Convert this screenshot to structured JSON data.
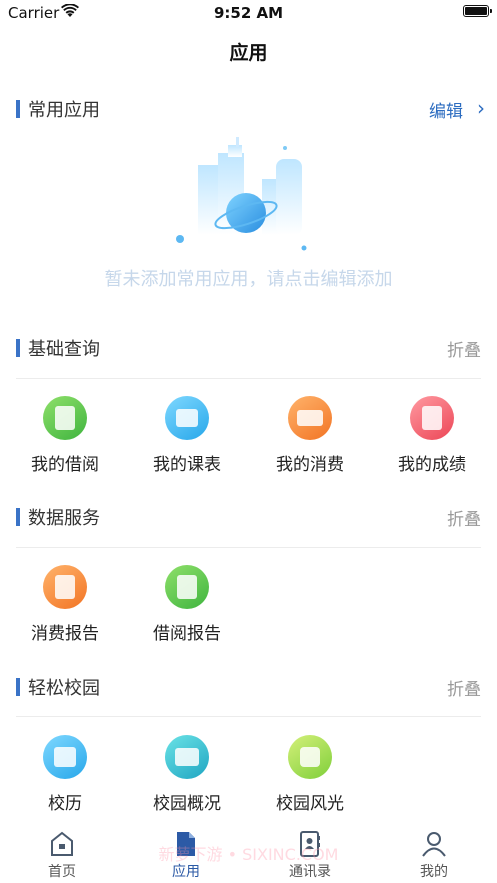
{
  "status_bar": {
    "carrier": "Carrier",
    "time": "9:52 AM"
  },
  "nav": {
    "title": "应用"
  },
  "common": {
    "title": "常用应用",
    "edit_label": "编辑",
    "empty_text": "暂未添加常用应用，请点击编辑添加"
  },
  "basic": {
    "title": "基础查询",
    "collapse_label": "折叠",
    "items": [
      {
        "label": "我的借阅",
        "icon": "id-card-icon",
        "color": "#3fb43f"
      },
      {
        "label": "我的课表",
        "icon": "calendar-grid-icon",
        "color": "#27a7ea"
      },
      {
        "label": "我的消费",
        "icon": "payment-card-icon",
        "color": "#f27424"
      },
      {
        "label": "我的成绩",
        "icon": "grade-a-plus-icon",
        "color": "#ec4656"
      }
    ]
  },
  "data": {
    "title": "数据服务",
    "collapse_label": "折叠",
    "items": [
      {
        "label": "消费报告",
        "icon": "yen-report-icon",
        "color": "#f27424"
      },
      {
        "label": "借阅报告",
        "icon": "id-card-icon",
        "color": "#3fb43f"
      }
    ]
  },
  "campus": {
    "title": "轻松校园",
    "collapse_label": "折叠",
    "items": [
      {
        "label": "校历",
        "icon": "calendar-icon",
        "color": "#27a7ea"
      },
      {
        "label": "校园概况",
        "icon": "building-icon",
        "color": "#1fa5c2"
      },
      {
        "label": "校园风光",
        "icon": "landscape-icon",
        "color": "#7fcf3a"
      }
    ]
  },
  "tabbar": {
    "tabs": [
      {
        "label": "首页",
        "icon": "home-icon"
      },
      {
        "label": "应用",
        "icon": "document-icon"
      },
      {
        "label": "通讯录",
        "icon": "contacts-icon"
      },
      {
        "label": "我的",
        "icon": "user-icon"
      }
    ]
  },
  "watermark": "新萝下游 • SIXINC.COM",
  "colors": {
    "accent": "#3a73c7",
    "link": "#2c6cc0"
  }
}
